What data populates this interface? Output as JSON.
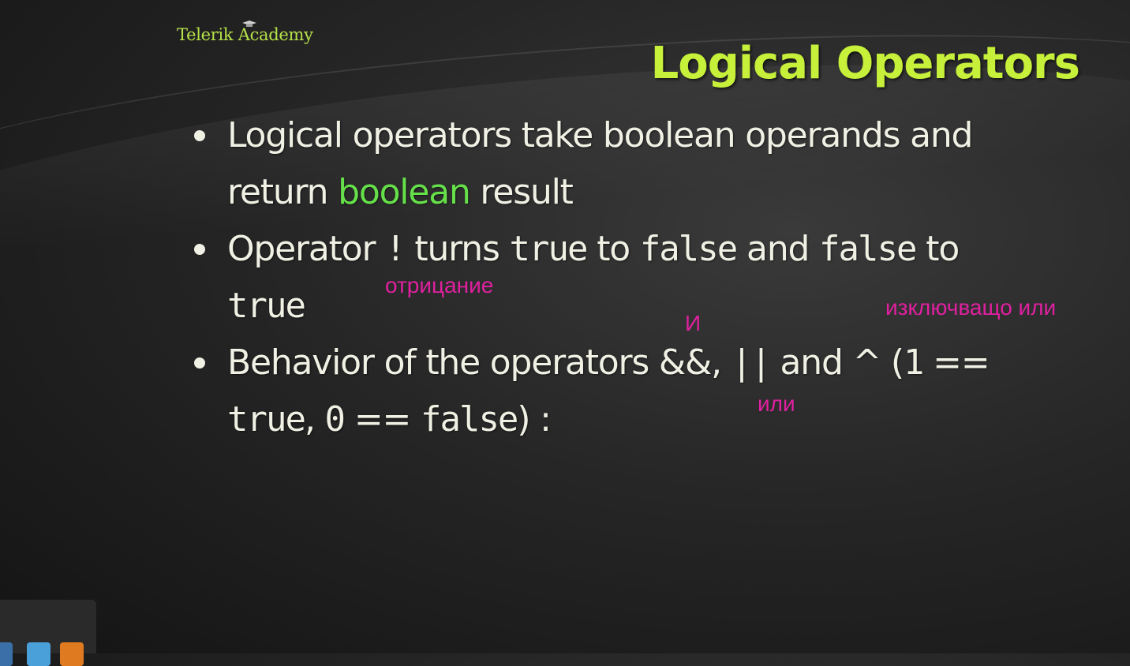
{
  "logo": {
    "text": "Telerik Academy"
  },
  "slide": {
    "title": "Logical Operators",
    "bullet1": {
      "line_a": "Logical operators take boolean operands and",
      "line_b_pre": "return ",
      "highlight": "boolean",
      "line_b_post": " result"
    },
    "bullet2": {
      "pre": "Operator ",
      "not_op": "!",
      "turns": " turns ",
      "true1": "true",
      "to1": " to ",
      "false1": "false",
      "and": " and ",
      "false2": "false",
      "to2": " to",
      "true2": "true"
    },
    "bullet3": {
      "pre": "Behavior of the operators ",
      "and_op": "&&",
      "comma": ", ",
      "or_op": "||",
      "and_word": " and ^ (",
      "one": "1",
      "eq1": " ==",
      "true": "true",
      "comma2": ", ",
      "zero": "0",
      "eq2": " == ",
      "false": "false",
      "end": ") :"
    }
  },
  "annotations": {
    "negation": "отрицание",
    "and": "И",
    "xor": "изключващо или",
    "or": "или"
  },
  "colors": {
    "title": "#c6f03a",
    "highlight": "#66e04a",
    "annotation": "#e020a0"
  },
  "social_icons": [
    "linkedin-icon",
    "twitter-icon",
    "rss-icon"
  ]
}
